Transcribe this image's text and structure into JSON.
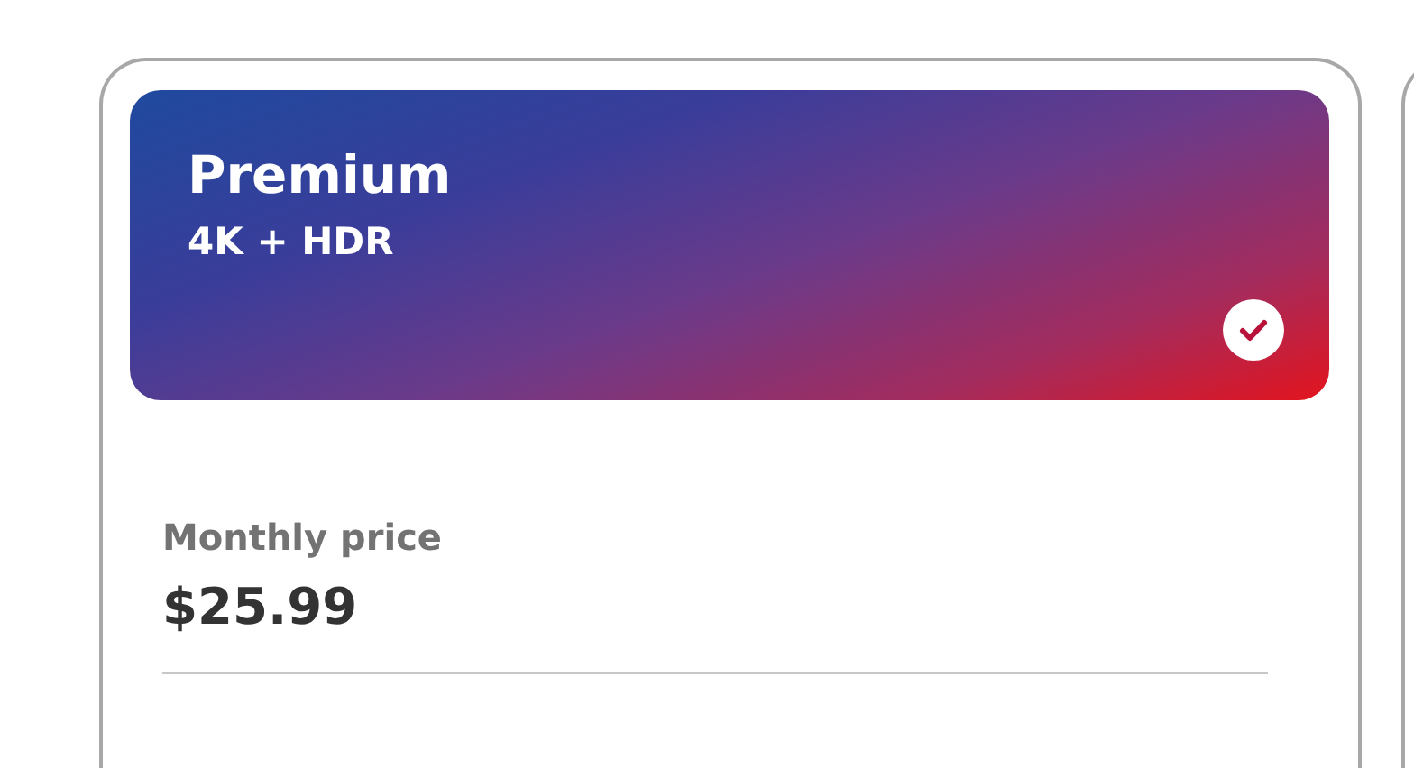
{
  "plan": {
    "name": "Premium",
    "quality": "4K + HDR",
    "selected": true,
    "price_label": "Monthly price",
    "price": "$25.99"
  }
}
